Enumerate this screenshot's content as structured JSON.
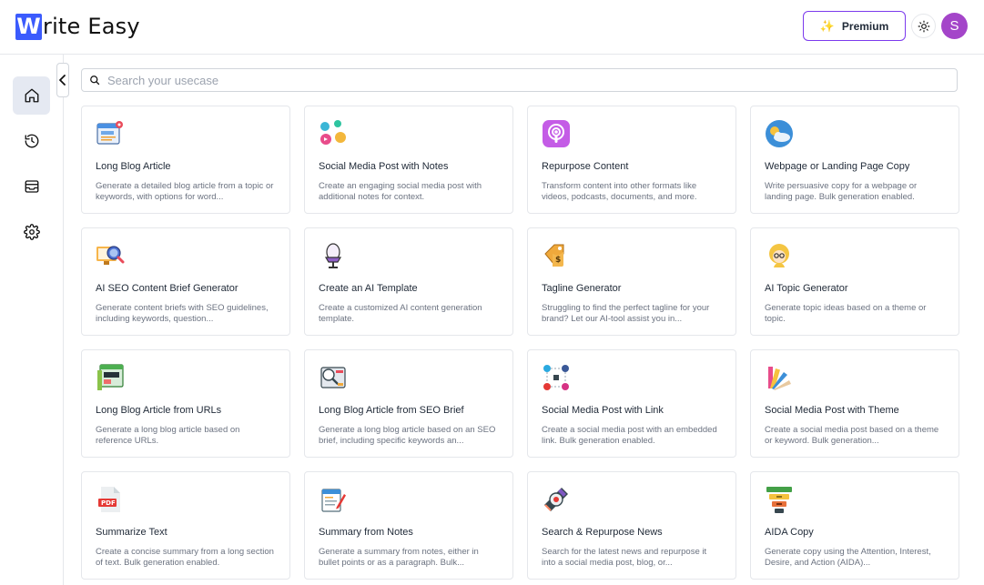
{
  "app": {
    "logo_letter": "W",
    "logo_rest": "rite Easy"
  },
  "header": {
    "premium_label": "Premium",
    "avatar_initial": "S"
  },
  "search": {
    "placeholder": "Search your usecase",
    "value": ""
  },
  "sidebar": {
    "items": [
      "home-icon",
      "history-icon",
      "inbox-icon",
      "settings-icon"
    ]
  },
  "cards": [
    {
      "title": "Long Blog Article",
      "desc": "Generate a detailed blog article from a topic or keywords, with options for word..."
    },
    {
      "title": "Social Media Post with Notes",
      "desc": "Create an engaging social media post with additional notes for context."
    },
    {
      "title": "Repurpose Content",
      "desc": "Transform content into other formats like videos, podcasts, documents, and more."
    },
    {
      "title": "Webpage or Landing Page Copy",
      "desc": "Write persuasive copy for a webpage or landing page. Bulk generation enabled."
    },
    {
      "title": "AI SEO Content Brief Generator",
      "desc": "Generate content briefs with SEO guidelines, including keywords, question..."
    },
    {
      "title": "Create an AI Template",
      "desc": "Create a customized AI content generation template."
    },
    {
      "title": "Tagline Generator",
      "desc": "Struggling to find the perfect tagline for your brand? Let our AI-tool assist you in..."
    },
    {
      "title": "AI Topic Generator",
      "desc": "Generate topic ideas based on a theme or topic."
    },
    {
      "title": "Long Blog Article from URLs",
      "desc": "Generate a long blog article based on reference URLs."
    },
    {
      "title": "Long Blog Article from SEO Brief",
      "desc": "Generate a long blog article based on an SEO brief, including specific keywords an..."
    },
    {
      "title": "Social Media Post with Link",
      "desc": "Create a social media post with an embedded link. Bulk generation enabled."
    },
    {
      "title": "Social Media Post with Theme",
      "desc": "Create a social media post based on a theme or keyword. Bulk generation..."
    },
    {
      "title": "Summarize Text",
      "desc": "Create a concise summary from a long section of text. Bulk generation enabled."
    },
    {
      "title": "Summary from Notes",
      "desc": "Generate a summary from notes, either in bullet points or as a paragraph. Bulk..."
    },
    {
      "title": "Search & Repurpose News",
      "desc": "Search for the latest news and repurpose it into a social media post, blog, or..."
    },
    {
      "title": "AIDA Copy",
      "desc": "Generate copy using the Attention, Interest, Desire, and Action (AIDA)..."
    }
  ],
  "colors": {
    "brand": "#3b5bfd",
    "premium_border": "#7c3aed",
    "avatar": "#a445c9"
  }
}
